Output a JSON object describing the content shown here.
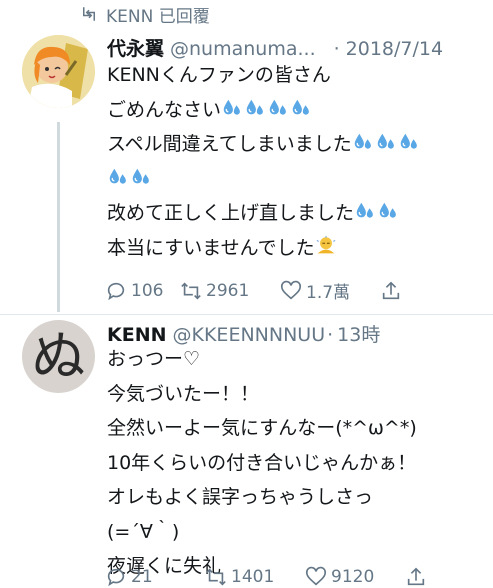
{
  "retweet_header": {
    "icon": "retweet-icon",
    "text": "KENN 已回覆"
  },
  "tweet1": {
    "display_name": "代永翼",
    "handle": "@numanuma...",
    "separator": "·",
    "date": "2018/7/14",
    "lines": [
      "KENNくんファンの皆さん",
      "ごめんなさい",
      "スペル間違えてしまいました",
      "",
      "改めて正しく上げ直しました",
      "本当にすいませんでした"
    ],
    "actions": {
      "reply": "106",
      "retweet": "2961",
      "like": "1.7萬"
    }
  },
  "tweet2": {
    "display_name": "KENN",
    "handle": "@KKEENNNNUU",
    "separator": "·",
    "date": "13時",
    "avatar_glyph": "ぬ",
    "lines": [
      "おっつー♡",
      "今気づいたー！！",
      "全然いーよー気にすんなー(*^ω^*)",
      "10年くらいの付き合いじゃんかぁ！",
      "オレもよく誤字っちゃうしさっ",
      "(=´∀｀)",
      "夜遅くに失礼"
    ],
    "actions": {
      "reply": "21",
      "retweet": "1401",
      "like": "9120"
    }
  },
  "colors": {
    "text": "#14171a",
    "secondary": "#657786",
    "droplet": "#5aa7e6"
  }
}
